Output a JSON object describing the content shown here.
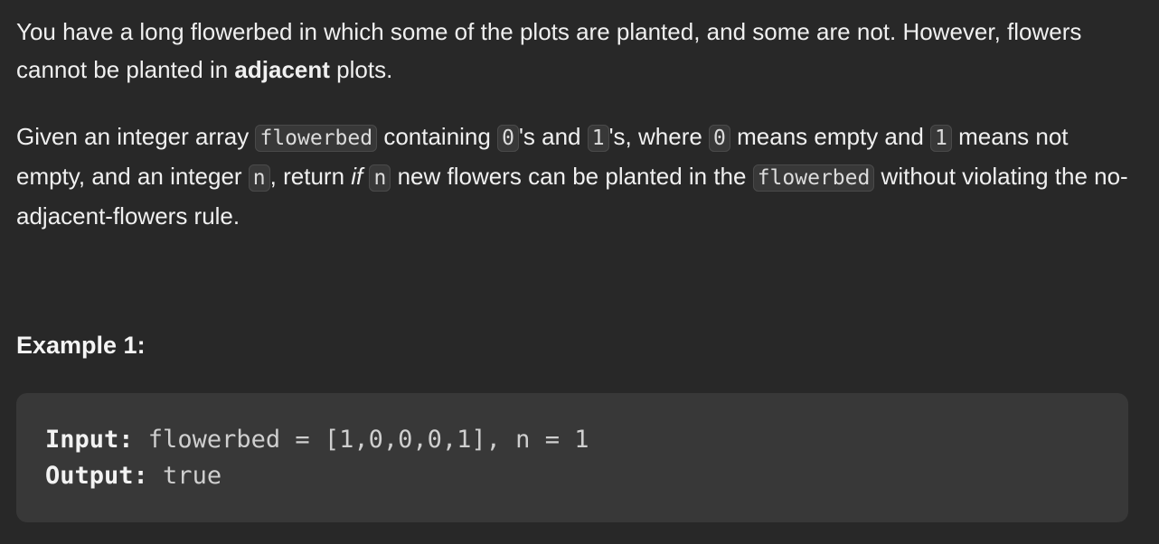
{
  "description": {
    "para1": {
      "text1": "You have a long flowerbed in which some of the plots are planted, and some are not. However, flowers cannot be planted in ",
      "bold": "adjacent",
      "text2": " plots."
    },
    "para2": {
      "t1": "Given an integer array ",
      "c1": "flowerbed",
      "t2": " containing ",
      "c2": "0",
      "t3": "'s and ",
      "c3": "1",
      "t4": "'s, where ",
      "c4": "0",
      "t5": " means empty and ",
      "c5": "1",
      "t6": " means not empty, and an integer ",
      "c6": "n",
      "t7": ", return ",
      "italic": "if",
      "t8": " ",
      "c7": "n",
      "t9": " new flowers can be planted in the ",
      "c8": "flowerbed",
      "t10": " without violating the no-adjacent-flowers rule."
    }
  },
  "example": {
    "heading": "Example 1:",
    "input_label": "Input:",
    "input_value": " flowerbed = [1,0,0,0,1], n = 1",
    "output_label": "Output:",
    "output_value": " true"
  }
}
